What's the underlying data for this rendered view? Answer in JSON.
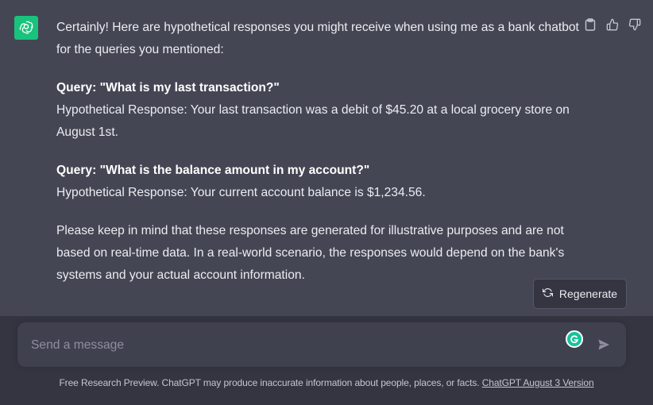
{
  "message": {
    "intro": "Certainly! Here are hypothetical responses you might receive when using me as a bank chatbot for the queries you mentioned:",
    "queries": [
      {
        "query": "Query: \"What is my last transaction?\"",
        "response": "Hypothetical Response: Your last transaction was a debit of $45.20 at a local grocery store on August 1st."
      },
      {
        "query": "Query: \"What is the balance amount in my account?\"",
        "response": "Hypothetical Response: Your current account balance is $1,234.56."
      }
    ],
    "closing": "Please keep in mind that these responses are generated for illustrative purposes and are not based on real-time data. In a real-world scenario, the responses would depend on the bank's systems and your actual account information."
  },
  "actions": {
    "copy_icon": "clipboard-icon",
    "like_icon": "thumbs-up-icon",
    "dislike_icon": "thumbs-down-icon"
  },
  "regenerate": {
    "label": "Regenerate",
    "icon": "refresh-icon"
  },
  "composer": {
    "placeholder": "Send a message",
    "value": ""
  },
  "footer": {
    "text": "Free Research Preview. ChatGPT may produce inaccurate information about people, places, or facts. ",
    "link": "ChatGPT August 3 Version"
  },
  "colors": {
    "message_bg": "#444654",
    "page_bg": "#343541",
    "input_bg": "#40414f",
    "avatar_green": "#19c37d",
    "text": "#ececf1"
  }
}
